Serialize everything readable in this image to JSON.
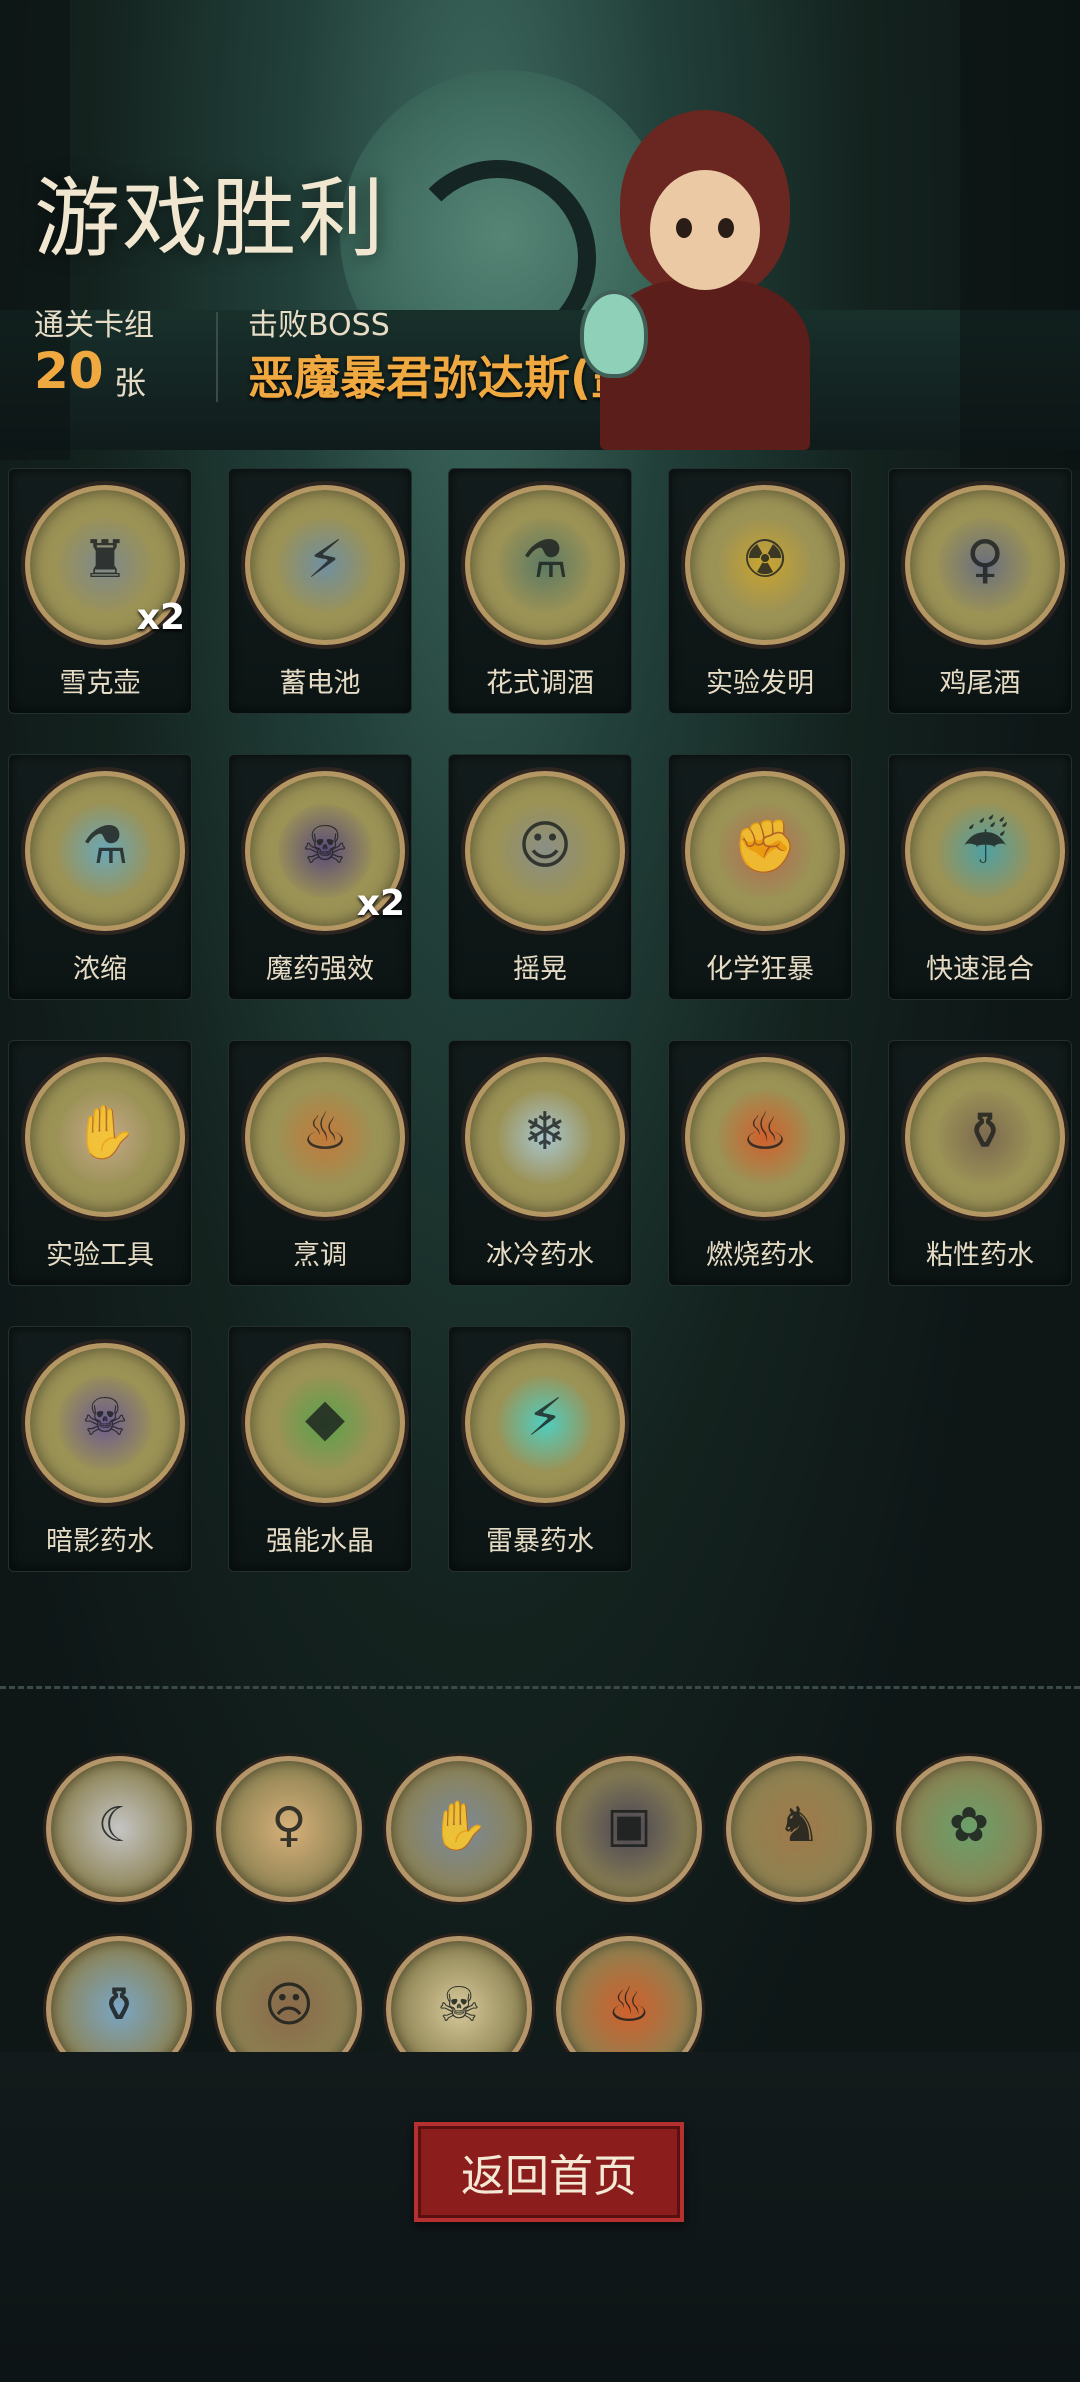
{
  "header": {
    "title": "游戏胜利",
    "deck_label": "通关卡组",
    "deck_count": "20",
    "deck_unit": "张",
    "boss_label": "击败BOSS",
    "boss_name": "恶魔暴君弥达斯(噩梦V)"
  },
  "cards": [
    {
      "name": "雪克壶",
      "multiplier": "x2",
      "icon": "shaker-icon",
      "glyph": "♜",
      "tint": "#7e8a8c"
    },
    {
      "name": "蓄电池",
      "multiplier": "",
      "icon": "battery-icon",
      "glyph": "⚡",
      "tint": "#6f8fa0"
    },
    {
      "name": "花式调酒",
      "multiplier": "",
      "icon": "bartender-icon",
      "glyph": "⚗",
      "tint": "#5c7a62"
    },
    {
      "name": "实验发明",
      "multiplier": "",
      "icon": "invention-icon",
      "glyph": "☢",
      "tint": "#c9a431"
    },
    {
      "name": "鸡尾酒",
      "multiplier": "",
      "icon": "cocktail-icon",
      "glyph": "♀",
      "tint": "#6a6f7e"
    },
    {
      "name": "浓缩",
      "multiplier": "",
      "icon": "distill-icon",
      "glyph": "⚗",
      "tint": "#6aa8b8"
    },
    {
      "name": "魔药强效",
      "multiplier": "x2",
      "icon": "potion-boost-icon",
      "glyph": "☠",
      "tint": "#5a4a7a"
    },
    {
      "name": "摇晃",
      "multiplier": "",
      "icon": "shake-icon",
      "glyph": "☺",
      "tint": "#8a8f86"
    },
    {
      "name": "化学狂暴",
      "multiplier": "",
      "icon": "rage-icon",
      "glyph": "✊",
      "tint": "#b26b52"
    },
    {
      "name": "快速混合",
      "multiplier": "",
      "icon": "quick-mix-icon",
      "glyph": "☔",
      "tint": "#4ea1a4"
    },
    {
      "name": "实验工具",
      "multiplier": "",
      "icon": "lab-tool-icon",
      "glyph": "✋",
      "tint": "#c7a98a"
    },
    {
      "name": "烹调",
      "multiplier": "",
      "icon": "cooking-icon",
      "glyph": "♨",
      "tint": "#c27a3a"
    },
    {
      "name": "冰冷药水",
      "multiplier": "",
      "icon": "ice-potion-icon",
      "glyph": "❄",
      "tint": "#a9c6cf"
    },
    {
      "name": "燃烧药水",
      "multiplier": "",
      "icon": "fire-potion-icon",
      "glyph": "♨",
      "tint": "#d0602c"
    },
    {
      "name": "粘性药水",
      "multiplier": "",
      "icon": "sticky-potion-icon",
      "glyph": "⚱",
      "tint": "#7c6a4f"
    },
    {
      "name": "暗影药水",
      "multiplier": "",
      "icon": "shadow-potion-icon",
      "glyph": "☠",
      "tint": "#6c5a8f"
    },
    {
      "name": "强能水晶",
      "multiplier": "",
      "icon": "crystal-icon",
      "glyph": "◆",
      "tint": "#5aa14a"
    },
    {
      "name": "雷暴药水",
      "multiplier": "",
      "icon": "thunder-potion-icon",
      "glyph": "⚡",
      "tint": "#4fcfc0"
    }
  ],
  "relics": [
    {
      "icon": "reaper-icon",
      "glyph": "☾",
      "tint": "#c5c5c5"
    },
    {
      "icon": "girl-portrait-icon",
      "glyph": "♀",
      "tint": "#d7b07a"
    },
    {
      "icon": "hand-claw-icon",
      "glyph": "✋",
      "tint": "#7b8a9a"
    },
    {
      "icon": "red-book-icon",
      "glyph": "▣",
      "tint": "#4a4555"
    },
    {
      "icon": "deer-icon",
      "glyph": "♞",
      "tint": "#a07a4a"
    },
    {
      "icon": "dryad-icon",
      "glyph": "✿",
      "tint": "#6aa06a"
    },
    {
      "icon": "ghost-bottle-icon",
      "glyph": "⚱",
      "tint": "#7aa6c5"
    },
    {
      "icon": "zombie-icon",
      "glyph": "☹",
      "tint": "#8a6a4a"
    },
    {
      "icon": "skull-totem-icon",
      "glyph": "☠",
      "tint": "#d6c89a"
    },
    {
      "icon": "flame-altar-icon",
      "glyph": "♨",
      "tint": "#d0602c"
    }
  ],
  "footer": {
    "home_label": "返回首页"
  },
  "colors": {
    "accent_gold": "#f0a841",
    "button_red": "#8c1d1d"
  }
}
